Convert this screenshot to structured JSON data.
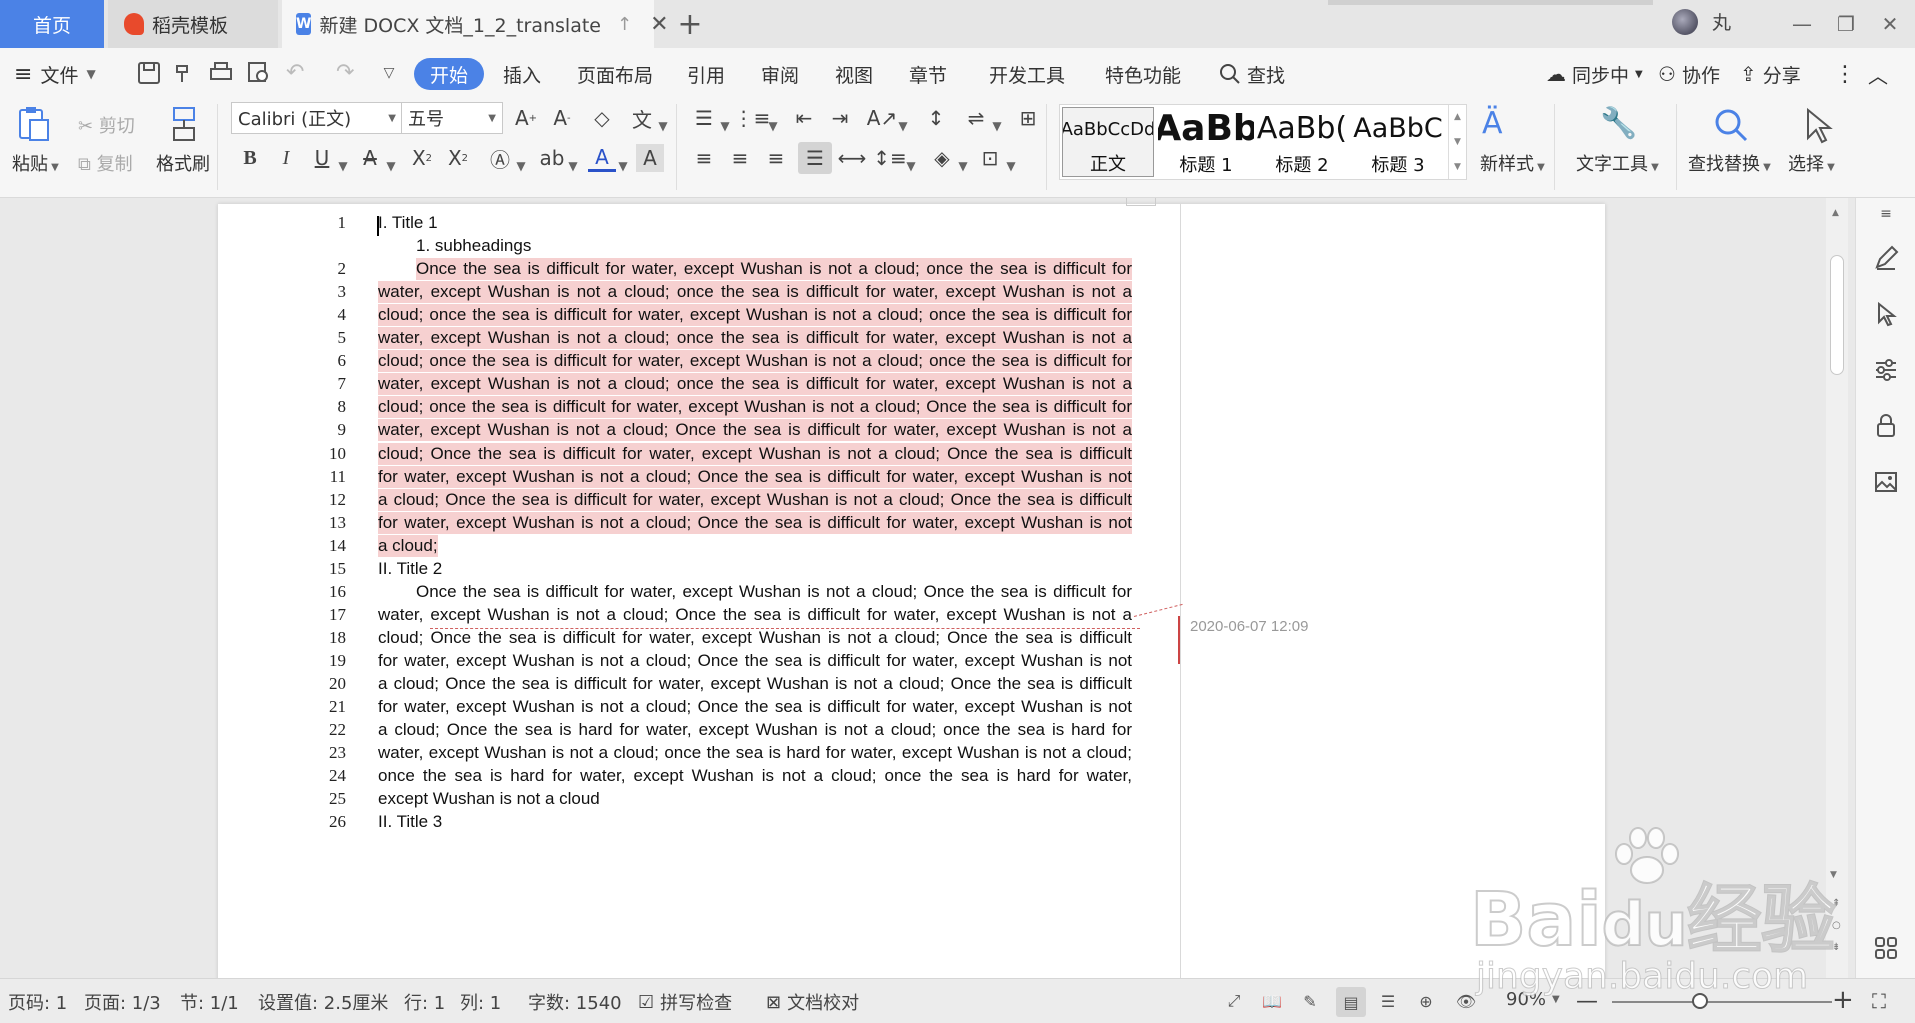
{
  "tabs": {
    "home": "首页",
    "daoke": "稻壳模板",
    "doc": "新建 DOCX 文档_1_2_translate",
    "doc_icon": "W"
  },
  "user": {
    "name": "丸"
  },
  "menu": {
    "file": "文件",
    "items": [
      "开始",
      "插入",
      "页面布局",
      "引用",
      "审阅",
      "视图",
      "章节",
      "开发工具",
      "特色功能"
    ],
    "search": "查找",
    "sync": "同步中",
    "collab": "协作",
    "share": "分享"
  },
  "ribbon": {
    "paste": "粘贴",
    "cut": "剪切",
    "copy": "复制",
    "format_painter": "格式刷",
    "font": "Calibri (正文)",
    "size": "五号",
    "styles": [
      {
        "sample": "AaBbCcDd",
        "label": "正文"
      },
      {
        "sample": "AaBb",
        "label": "标题 1"
      },
      {
        "sample": "AaBb(",
        "label": "标题 2"
      },
      {
        "sample": "AaBbC",
        "label": "标题 3"
      }
    ],
    "new_style": "新样式",
    "text_tools": "文字工具",
    "find_replace": "查找替换",
    "select": "选择"
  },
  "document": {
    "lines": [
      {
        "n": "1",
        "text": "I. Title 1",
        "hl": false,
        "mode": "left"
      },
      {
        "n": "",
        "text": "1. subheadings",
        "hl": false,
        "mode": "indent-left"
      },
      {
        "n": "2",
        "text": "Once the sea is difficult for water, except Wushan is not a cloud; once the sea is difficult for",
        "hl": true,
        "mode": "indent"
      },
      {
        "n": "3",
        "text": "water, except Wushan is not a cloud; once the sea is difficult for water, except Wushan is not a",
        "hl": true,
        "mode": "justify"
      },
      {
        "n": "4",
        "text": "cloud; once the sea is difficult for water, except Wushan is not a cloud; once the sea is difficult for",
        "hl": true,
        "mode": "justify"
      },
      {
        "n": "5",
        "text": "water, except Wushan is not a cloud; once the sea is difficult for water, except Wushan is not a",
        "hl": true,
        "mode": "justify"
      },
      {
        "n": "6",
        "text": "cloud; once the sea is difficult for water, except Wushan is not a cloud; once the sea is difficult for",
        "hl": true,
        "mode": "justify"
      },
      {
        "n": "7",
        "text": "water, except Wushan is not a cloud; once the sea is difficult for water, except Wushan is not a",
        "hl": true,
        "mode": "justify"
      },
      {
        "n": "8",
        "text": "cloud; once the sea is difficult for water, except Wushan is not a cloud; Once the sea is difficult for",
        "hl": true,
        "mode": "justify"
      },
      {
        "n": "9",
        "text": "water, except Wushan is not a cloud; Once the sea is difficult for water, except Wushan is not a",
        "hl": true,
        "mode": "justify"
      },
      {
        "n": "10",
        "text": "cloud; Once the sea is difficult for water, except Wushan is not a cloud; Once the sea is difficult",
        "hl": true,
        "mode": "justify"
      },
      {
        "n": "11",
        "text": "for water, except Wushan is not a cloud; Once the sea is difficult for water, except Wushan is not",
        "hl": true,
        "mode": "justify"
      },
      {
        "n": "12",
        "text": "a cloud; Once the sea is difficult for water, except Wushan is not a cloud; Once the sea is difficult",
        "hl": true,
        "mode": "justify"
      },
      {
        "n": "13",
        "text": "for water, except Wushan is not a cloud; Once the sea is difficult for water, except Wushan is not",
        "hl": true,
        "mode": "justify"
      },
      {
        "n": "14",
        "text": "a cloud;",
        "hl": true,
        "mode": "short"
      },
      {
        "n": "15",
        "text": "II. Title 2",
        "hl": false,
        "mode": "left"
      },
      {
        "n": "16",
        "text": "Once the sea is difficult for water, except Wushan is not a cloud; Once the sea is difficult for",
        "hl": false,
        "mode": "indent"
      },
      {
        "n": "17",
        "text": "water, except Wushan is not a cloud; Once the sea is difficult for water, except Wushan is not a",
        "hl": false,
        "mode": "justify"
      },
      {
        "n": "18",
        "text": "cloud; Once the sea is difficult for water, except Wushan is not a cloud; Once the sea is difficult",
        "hl": false,
        "mode": "justify"
      },
      {
        "n": "19",
        "text": "for water, except Wushan is not a cloud; Once the sea is difficult for water, except Wushan is not",
        "hl": false,
        "mode": "justify"
      },
      {
        "n": "20",
        "text": "a cloud; Once the sea is difficult for water, except Wushan is not a cloud; Once the sea is difficult",
        "hl": false,
        "mode": "justify"
      },
      {
        "n": "21",
        "text": "for water, except Wushan is not a cloud; Once the sea is difficult for water, except Wushan is not",
        "hl": false,
        "mode": "justify"
      },
      {
        "n": "22",
        "text": "a cloud; Once the sea is hard for water, except Wushan is not a cloud; once the sea is hard for",
        "hl": false,
        "mode": "justify"
      },
      {
        "n": "23",
        "text": "water, except Wushan is not a cloud; once the sea is hard for water, except Wushan is not a cloud;",
        "hl": false,
        "mode": "justify"
      },
      {
        "n": "24",
        "text": "once the sea is hard for water, except Wushan is not a cloud; once the sea is hard for water,",
        "hl": false,
        "mode": "justify"
      },
      {
        "n": "25",
        "text": "except Wushan is not a cloud",
        "hl": false,
        "mode": "left"
      },
      {
        "n": "26",
        "text": "II. Title 3",
        "hl": false,
        "mode": "left"
      }
    ],
    "comment_time": "2020-06-07 12:09"
  },
  "status": {
    "page_num": "页码: 1",
    "pages": "页面: 1/3",
    "section": "节: 1/1",
    "setting": "设置值: 2.5厘米",
    "row": "行: 1",
    "col": "列: 1",
    "words": "字数: 1540",
    "spell": "拼写检查",
    "proof": "文档校对",
    "zoom": "90%",
    "zoom_value": 0.4
  },
  "watermark": {
    "brand": "Bai",
    "brand2": "经验",
    "url": "jingyan.baidu.com"
  },
  "colors": {
    "accent": "#4b82e6",
    "highlight": "#f6d0d0",
    "comment": "#c44444"
  }
}
